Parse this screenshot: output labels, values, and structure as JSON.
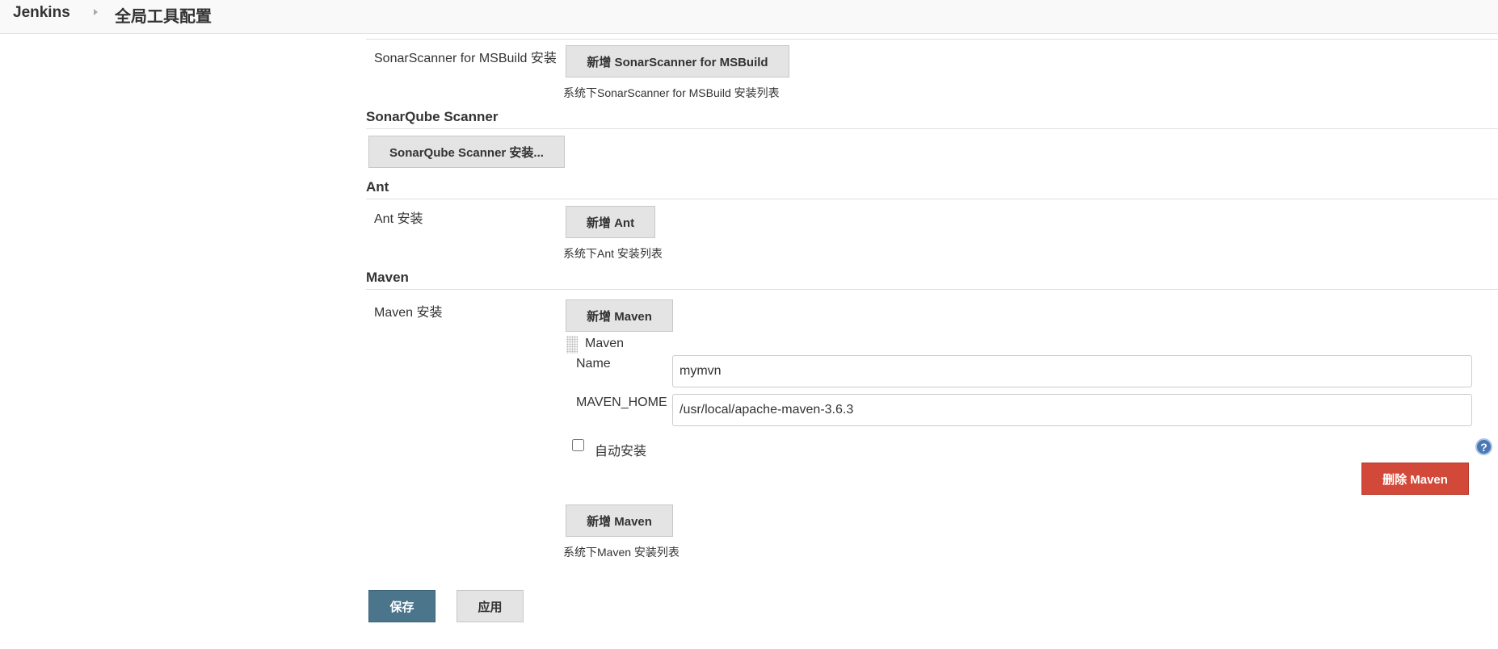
{
  "breadcrumb": {
    "root": "Jenkins",
    "page": "全局工具配置"
  },
  "sonar_msbuild": {
    "label": "SonarScanner for MSBuild 安装",
    "add_button": "新增 SonarScanner for MSBuild",
    "hint": "系统下SonarScanner for MSBuild 安装列表"
  },
  "sonarqube_scanner": {
    "title": "SonarQube Scanner",
    "install_button": "SonarQube Scanner 安装..."
  },
  "ant": {
    "title": "Ant",
    "label": "Ant 安装",
    "add_button": "新增 Ant",
    "hint": "系统下Ant 安装列表"
  },
  "maven": {
    "title": "Maven",
    "label": "Maven 安装",
    "add_button_top": "新增 Maven",
    "installation": {
      "header": "Maven",
      "name_label": "Name",
      "name_value": "mymvn",
      "home_label": "MAVEN_HOME",
      "home_value": "/usr/local/apache-maven-3.6.3",
      "auto_install_label": "自动安装",
      "auto_install_checked": false,
      "delete_button": "删除 Maven",
      "help": "?"
    },
    "add_button_bottom": "新增 Maven",
    "hint": "系统下Maven 安装列表"
  },
  "actions": {
    "save": "保存",
    "apply": "应用"
  },
  "colors": {
    "primary": "#4b758b",
    "danger": "#d24939",
    "help": "#4a78b5"
  }
}
